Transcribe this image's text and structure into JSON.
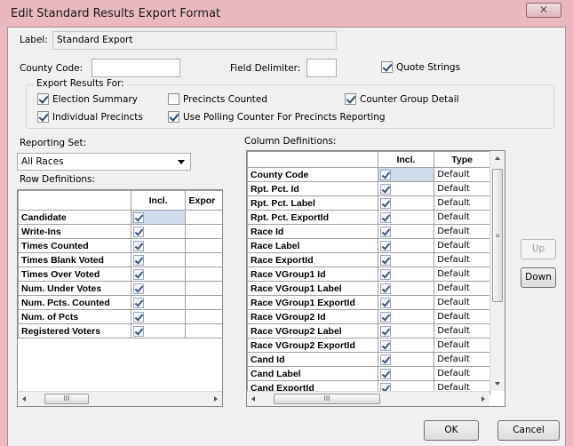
{
  "window": {
    "title": "Edit Standard Results Export Format",
    "close_glyph": "✕"
  },
  "label_field": {
    "label": "Label:",
    "value": "Standard Export"
  },
  "county_code": {
    "label": "County Code:",
    "value": ""
  },
  "field_delimiter": {
    "label": "Field Delimiter:",
    "value": ""
  },
  "quote_strings": {
    "label": "Quote Strings",
    "checked": true
  },
  "export_results": {
    "title": "Export Results For:",
    "options": [
      {
        "label": "Election Summary",
        "checked": true
      },
      {
        "label": "Precincts Counted",
        "checked": false
      },
      {
        "label": "Counter Group Detail",
        "checked": true
      },
      {
        "label": "Individual Precincts",
        "checked": true
      },
      {
        "label": "Use Polling Counter For Precincts Reporting",
        "checked": true
      }
    ]
  },
  "reporting_set": {
    "label": "Reporting Set:",
    "selected": "All Races"
  },
  "row_definitions": {
    "label": "Row Definitions:",
    "headers": [
      "",
      "Incl.",
      "Expor"
    ],
    "rows": [
      {
        "name": "Candidate",
        "incl": true
      },
      {
        "name": "Write-Ins",
        "incl": true
      },
      {
        "name": "Times Counted",
        "incl": true
      },
      {
        "name": "Times Blank Voted",
        "incl": true
      },
      {
        "name": "Times Over Voted",
        "incl": true
      },
      {
        "name": "Num. Under Votes",
        "incl": true
      },
      {
        "name": "Num. Pcts. Counted",
        "incl": true
      },
      {
        "name": "Num. of Pcts",
        "incl": true
      },
      {
        "name": "Registered Voters",
        "incl": true
      }
    ],
    "scroll_thumb": "III"
  },
  "column_definitions": {
    "label": "Column Definitions:",
    "headers": [
      "",
      "Incl.",
      "Type"
    ],
    "rows": [
      {
        "name": "County Code",
        "incl": true,
        "type": "Default"
      },
      {
        "name": "Rpt. Pct. Id",
        "incl": true,
        "type": "Default"
      },
      {
        "name": "Rpt. Pct. Label",
        "incl": true,
        "type": "Default"
      },
      {
        "name": "Rpt. Pct. ExportId",
        "incl": true,
        "type": "Default"
      },
      {
        "name": "Race Id",
        "incl": true,
        "type": "Default"
      },
      {
        "name": "Race Label",
        "incl": true,
        "type": "Default"
      },
      {
        "name": "Race ExportId",
        "incl": true,
        "type": "Default"
      },
      {
        "name": "Race VGroup1 Id",
        "incl": true,
        "type": "Default"
      },
      {
        "name": "Race VGroup1 Label",
        "incl": true,
        "type": "Default"
      },
      {
        "name": "Race VGroup1 ExportId",
        "incl": true,
        "type": "Default"
      },
      {
        "name": "Race VGroup2 Id",
        "incl": true,
        "type": "Default"
      },
      {
        "name": "Race VGroup2 Label",
        "incl": true,
        "type": "Default"
      },
      {
        "name": "Race VGroup2 ExportId",
        "incl": true,
        "type": "Default"
      },
      {
        "name": "Cand Id",
        "incl": true,
        "type": "Default"
      },
      {
        "name": "Cand Label",
        "incl": true,
        "type": "Default"
      },
      {
        "name": "Cand ExportId",
        "incl": true,
        "type": "Default"
      }
    ],
    "scroll_thumb": "III"
  },
  "buttons": {
    "up": "Up",
    "down": "Down",
    "ok": "OK",
    "cancel": "Cancel"
  }
}
